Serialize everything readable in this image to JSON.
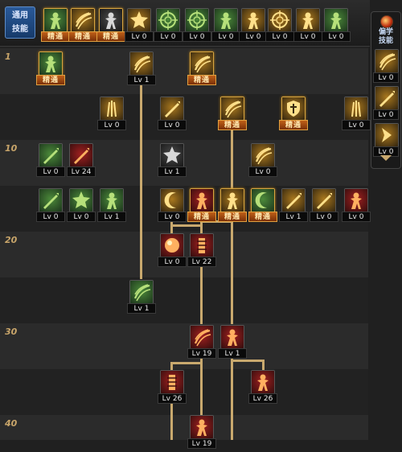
{
  "header": {
    "common_label": "通用\n技能",
    "common_label_l1": "通用",
    "common_label_l2": "技能"
  },
  "master_text": "精通",
  "row_levels": [
    "1",
    "10",
    "20",
    "30",
    "40"
  ],
  "colors": {
    "gold_line": "#c9a96e",
    "master_border": "#d9a640",
    "master_badge": "#c06018"
  },
  "common_skills": [
    {
      "icon": "kneel-figure-icon",
      "level": "精通",
      "master": true
    },
    {
      "icon": "claw-slash-icon",
      "level": "精通",
      "master": true
    },
    {
      "icon": "running-figure-icon",
      "level": "精通",
      "master": true
    },
    {
      "icon": "winged-burst-icon",
      "level": "Lv 0",
      "master": false
    },
    {
      "icon": "target-crosshair-icon",
      "level": "Lv 0",
      "master": false
    },
    {
      "icon": "green-crosshair-icon",
      "level": "Lv 0",
      "master": false
    },
    {
      "icon": "kneeling-fighter-icon",
      "level": "Lv 0",
      "master": false
    },
    {
      "icon": "rising-figure-icon",
      "level": "Lv 0",
      "master": false
    },
    {
      "icon": "concentric-circle-icon",
      "level": "Lv 0",
      "master": false
    },
    {
      "icon": "muscle-pose-icon",
      "level": "Lv 0",
      "master": false
    },
    {
      "icon": "green-flame-figure-icon",
      "level": "Lv 0",
      "master": false
    }
  ],
  "side_panel": {
    "label_l1": "偏学",
    "label_l2": "技能",
    "skills": [
      {
        "icon": "wind-slash-icon",
        "level": "Lv 0"
      },
      {
        "icon": "spear-wave-icon",
        "level": "Lv 0"
      },
      {
        "icon": "chevron-strike-icon",
        "level": "Lv 0"
      }
    ]
  },
  "tree_skills": [
    {
      "id": "s1",
      "icon": "green-helmet-icon",
      "level": "精通",
      "master": true
    },
    {
      "id": "s2",
      "icon": "claw-rake-icon",
      "level": "Lv 1",
      "master": false
    },
    {
      "id": "s3",
      "icon": "swift-claw-icon",
      "level": "精通",
      "master": true
    },
    {
      "id": "s4",
      "icon": "feather-spike-icon",
      "level": "Lv 0",
      "master": false
    },
    {
      "id": "s5",
      "icon": "arrow-thrust-icon",
      "level": "Lv 0",
      "master": false
    },
    {
      "id": "s6",
      "icon": "whirl-slash-icon",
      "level": "精通",
      "master": true
    },
    {
      "id": "s7",
      "icon": "cross-shield-icon",
      "level": "精通",
      "master": true
    },
    {
      "id": "s8",
      "icon": "triple-spike-icon",
      "level": "Lv 0",
      "master": false
    },
    {
      "id": "s9",
      "icon": "green-blade-icon",
      "level": "Lv 0",
      "master": false
    },
    {
      "id": "s10",
      "icon": "red-blade-icon",
      "level": "Lv 24",
      "master": false
    },
    {
      "id": "s11",
      "icon": "flame-burst-icon",
      "level": "Lv 1",
      "master": false
    },
    {
      "id": "s12",
      "icon": "swirl-wave-icon",
      "level": "Lv 0",
      "master": false
    },
    {
      "id": "s13",
      "icon": "long-blade-icon",
      "level": "Lv 0",
      "master": false
    },
    {
      "id": "s14",
      "icon": "green-star-burst-icon",
      "level": "Lv 0",
      "master": false
    },
    {
      "id": "s15",
      "icon": "dash-cut-icon",
      "level": "Lv 1",
      "master": false
    },
    {
      "id": "s16",
      "icon": "crescent-kick-icon",
      "level": "Lv 0",
      "master": false
    },
    {
      "id": "s17",
      "icon": "burning-palm-icon",
      "level": "精通",
      "master": true
    },
    {
      "id": "s18",
      "icon": "tiger-roar-icon",
      "level": "精通",
      "master": true
    },
    {
      "id": "s19",
      "icon": "green-crescent-icon",
      "level": "精通",
      "master": true
    },
    {
      "id": "s20",
      "icon": "wind-blades-icon",
      "level": "Lv 1",
      "master": false
    },
    {
      "id": "s21",
      "icon": "cross-thrust-icon",
      "level": "Lv 0",
      "master": false
    },
    {
      "id": "s22",
      "icon": "fire-crown-icon",
      "level": "Lv 0",
      "master": false
    },
    {
      "id": "s23",
      "icon": "fire-orb-icon",
      "level": "Lv 0",
      "master": false
    },
    {
      "id": "s24",
      "icon": "red-tower-icon",
      "level": "Lv 22",
      "master": false
    },
    {
      "id": "s25",
      "icon": "tornado-icon",
      "level": "Lv 1",
      "master": false
    },
    {
      "id": "s26",
      "icon": "red-slash-icon",
      "level": "Lv 19",
      "master": false
    },
    {
      "id": "s27",
      "icon": "beast-fist-icon",
      "level": "Lv 1",
      "master": false
    },
    {
      "id": "s28",
      "icon": "red-pillar-icon",
      "level": "Lv 26",
      "master": false
    },
    {
      "id": "s29",
      "icon": "red-beast-icon",
      "level": "Lv 26",
      "master": false
    },
    {
      "id": "s30",
      "icon": "skull-strike-icon",
      "level": "Lv 19",
      "master": false
    }
  ]
}
